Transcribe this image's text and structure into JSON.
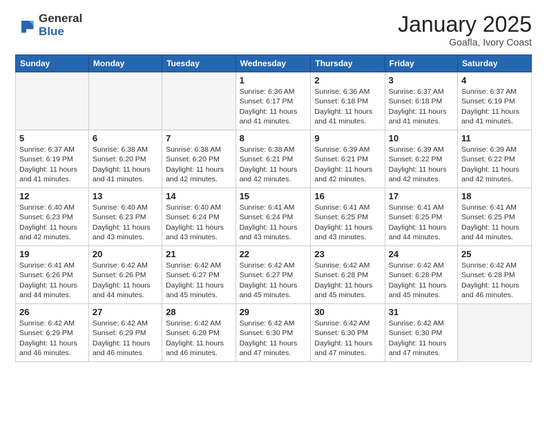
{
  "logo": {
    "general": "General",
    "blue": "Blue"
  },
  "title": {
    "month": "January 2025",
    "location": "Goafla, Ivory Coast"
  },
  "weekdays": [
    "Sunday",
    "Monday",
    "Tuesday",
    "Wednesday",
    "Thursday",
    "Friday",
    "Saturday"
  ],
  "weeks": [
    [
      {
        "day": "",
        "info": ""
      },
      {
        "day": "",
        "info": ""
      },
      {
        "day": "",
        "info": ""
      },
      {
        "day": "1",
        "info": "Sunrise: 6:36 AM\nSunset: 6:17 PM\nDaylight: 11 hours and 41 minutes."
      },
      {
        "day": "2",
        "info": "Sunrise: 6:36 AM\nSunset: 6:18 PM\nDaylight: 11 hours and 41 minutes."
      },
      {
        "day": "3",
        "info": "Sunrise: 6:37 AM\nSunset: 6:18 PM\nDaylight: 11 hours and 41 minutes."
      },
      {
        "day": "4",
        "info": "Sunrise: 6:37 AM\nSunset: 6:19 PM\nDaylight: 11 hours and 41 minutes."
      }
    ],
    [
      {
        "day": "5",
        "info": "Sunrise: 6:37 AM\nSunset: 6:19 PM\nDaylight: 11 hours and 41 minutes."
      },
      {
        "day": "6",
        "info": "Sunrise: 6:38 AM\nSunset: 6:20 PM\nDaylight: 11 hours and 41 minutes."
      },
      {
        "day": "7",
        "info": "Sunrise: 6:38 AM\nSunset: 6:20 PM\nDaylight: 11 hours and 42 minutes."
      },
      {
        "day": "8",
        "info": "Sunrise: 6:38 AM\nSunset: 6:21 PM\nDaylight: 11 hours and 42 minutes."
      },
      {
        "day": "9",
        "info": "Sunrise: 6:39 AM\nSunset: 6:21 PM\nDaylight: 11 hours and 42 minutes."
      },
      {
        "day": "10",
        "info": "Sunrise: 6:39 AM\nSunset: 6:22 PM\nDaylight: 11 hours and 42 minutes."
      },
      {
        "day": "11",
        "info": "Sunrise: 6:39 AM\nSunset: 6:22 PM\nDaylight: 11 hours and 42 minutes."
      }
    ],
    [
      {
        "day": "12",
        "info": "Sunrise: 6:40 AM\nSunset: 6:23 PM\nDaylight: 11 hours and 42 minutes."
      },
      {
        "day": "13",
        "info": "Sunrise: 6:40 AM\nSunset: 6:23 PM\nDaylight: 11 hours and 43 minutes."
      },
      {
        "day": "14",
        "info": "Sunrise: 6:40 AM\nSunset: 6:24 PM\nDaylight: 11 hours and 43 minutes."
      },
      {
        "day": "15",
        "info": "Sunrise: 6:41 AM\nSunset: 6:24 PM\nDaylight: 11 hours and 43 minutes."
      },
      {
        "day": "16",
        "info": "Sunrise: 6:41 AM\nSunset: 6:25 PM\nDaylight: 11 hours and 43 minutes."
      },
      {
        "day": "17",
        "info": "Sunrise: 6:41 AM\nSunset: 6:25 PM\nDaylight: 11 hours and 44 minutes."
      },
      {
        "day": "18",
        "info": "Sunrise: 6:41 AM\nSunset: 6:25 PM\nDaylight: 11 hours and 44 minutes."
      }
    ],
    [
      {
        "day": "19",
        "info": "Sunrise: 6:41 AM\nSunset: 6:26 PM\nDaylight: 11 hours and 44 minutes."
      },
      {
        "day": "20",
        "info": "Sunrise: 6:42 AM\nSunset: 6:26 PM\nDaylight: 11 hours and 44 minutes."
      },
      {
        "day": "21",
        "info": "Sunrise: 6:42 AM\nSunset: 6:27 PM\nDaylight: 11 hours and 45 minutes."
      },
      {
        "day": "22",
        "info": "Sunrise: 6:42 AM\nSunset: 6:27 PM\nDaylight: 11 hours and 45 minutes."
      },
      {
        "day": "23",
        "info": "Sunrise: 6:42 AM\nSunset: 6:28 PM\nDaylight: 11 hours and 45 minutes."
      },
      {
        "day": "24",
        "info": "Sunrise: 6:42 AM\nSunset: 6:28 PM\nDaylight: 11 hours and 45 minutes."
      },
      {
        "day": "25",
        "info": "Sunrise: 6:42 AM\nSunset: 6:28 PM\nDaylight: 11 hours and 46 minutes."
      }
    ],
    [
      {
        "day": "26",
        "info": "Sunrise: 6:42 AM\nSunset: 6:29 PM\nDaylight: 11 hours and 46 minutes."
      },
      {
        "day": "27",
        "info": "Sunrise: 6:42 AM\nSunset: 6:29 PM\nDaylight: 11 hours and 46 minutes."
      },
      {
        "day": "28",
        "info": "Sunrise: 6:42 AM\nSunset: 6:29 PM\nDaylight: 11 hours and 46 minutes."
      },
      {
        "day": "29",
        "info": "Sunrise: 6:42 AM\nSunset: 6:30 PM\nDaylight: 11 hours and 47 minutes."
      },
      {
        "day": "30",
        "info": "Sunrise: 6:42 AM\nSunset: 6:30 PM\nDaylight: 11 hours and 47 minutes."
      },
      {
        "day": "31",
        "info": "Sunrise: 6:42 AM\nSunset: 6:30 PM\nDaylight: 11 hours and 47 minutes."
      },
      {
        "day": "",
        "info": ""
      }
    ]
  ]
}
